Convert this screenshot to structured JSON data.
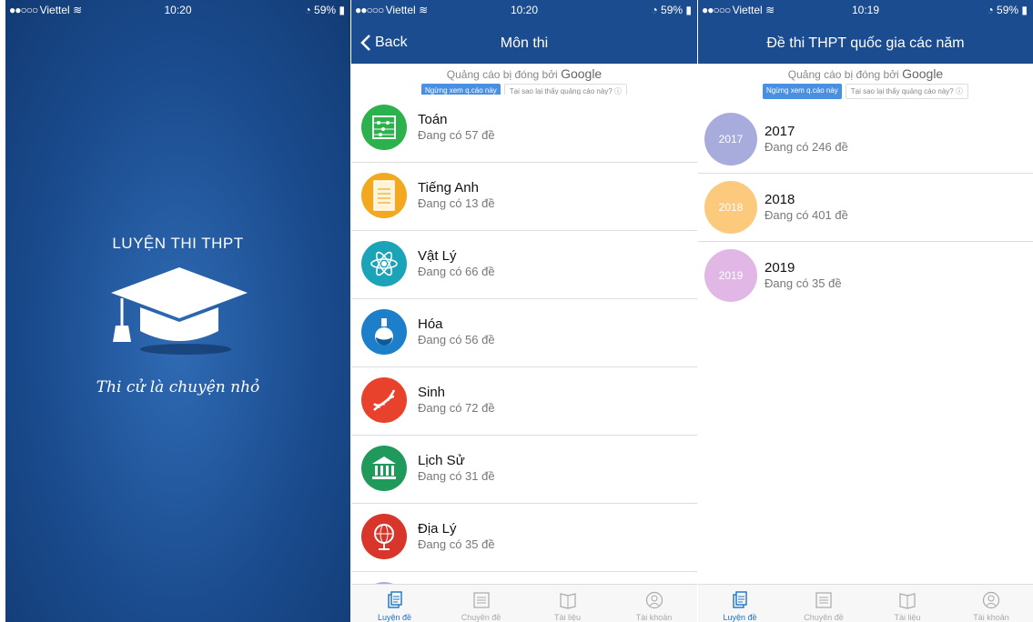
{
  "screen1": {
    "status": {
      "carrier": "Viettel",
      "time": "10:20",
      "battery": "59%"
    },
    "title": "LUYỆN THI THPT",
    "slogan": "Thi cử là chuyện nhỏ"
  },
  "screen2": {
    "status": {
      "carrier": "Viettel",
      "time": "10:20",
      "battery": "59%"
    },
    "nav": {
      "back": "Back",
      "title": "Môn thi"
    },
    "ad": {
      "text": "Quảng cáo bị đóng bởi",
      "brand": "Google",
      "stop": "Ngừng xem q.cáo này",
      "why": "Tại sao lại thấy quảng cáo này? ⓘ"
    },
    "subjects": [
      {
        "name": "Toán",
        "count": "Đang có 57 đề",
        "icon": "abacus-icon",
        "color": "#2bb24c"
      },
      {
        "name": "Tiếng Anh",
        "count": "Đang có 13 đề",
        "icon": "test-paper-icon",
        "color": "#f2a91f"
      },
      {
        "name": "Vật Lý",
        "count": "Đang có 66 đề",
        "icon": "atom-icon",
        "color": "#1ba3b8"
      },
      {
        "name": "Hóa",
        "count": "Đang có 56 đề",
        "icon": "flask-icon",
        "color": "#1d7fc9"
      },
      {
        "name": "Sinh",
        "count": "Đang có 72 đề",
        "icon": "dna-icon",
        "color": "#e8412c"
      },
      {
        "name": "Lịch Sử",
        "count": "Đang có 31 đề",
        "icon": "museum-icon",
        "color": "#1f9a5a"
      },
      {
        "name": "Địa Lý",
        "count": "Đang có 35 đề",
        "icon": "globe-icon",
        "color": "#d8362b"
      }
    ],
    "tabs": [
      "Luyện đề",
      "Chuyên đề",
      "Tài liệu",
      "Tài khoản"
    ]
  },
  "screen3": {
    "status": {
      "carrier": "Viettel",
      "time": "10:19",
      "battery": "59%"
    },
    "nav": {
      "title": "Đề thi THPT quốc gia các năm"
    },
    "ad": {
      "text": "Quảng cáo bị đóng bởi",
      "brand": "Google",
      "stop": "Ngừng xem q.cáo này",
      "why": "Tại sao lại thấy quảng cáo này? ⓘ"
    },
    "years": [
      {
        "badge": "2017",
        "label": "2017",
        "count": "Đang có 246 đề",
        "color": "#a7acdc"
      },
      {
        "badge": "2018",
        "label": "2018",
        "count": "Đang có 401 đề",
        "color": "#fcca7c"
      },
      {
        "badge": "2019",
        "label": "2019",
        "count": "Đang có 35 đề",
        "color": "#e1b7e6"
      }
    ],
    "tabs": [
      "Luyện đề",
      "Chuyên đề",
      "Tài liệu",
      "Tài khoản"
    ]
  }
}
